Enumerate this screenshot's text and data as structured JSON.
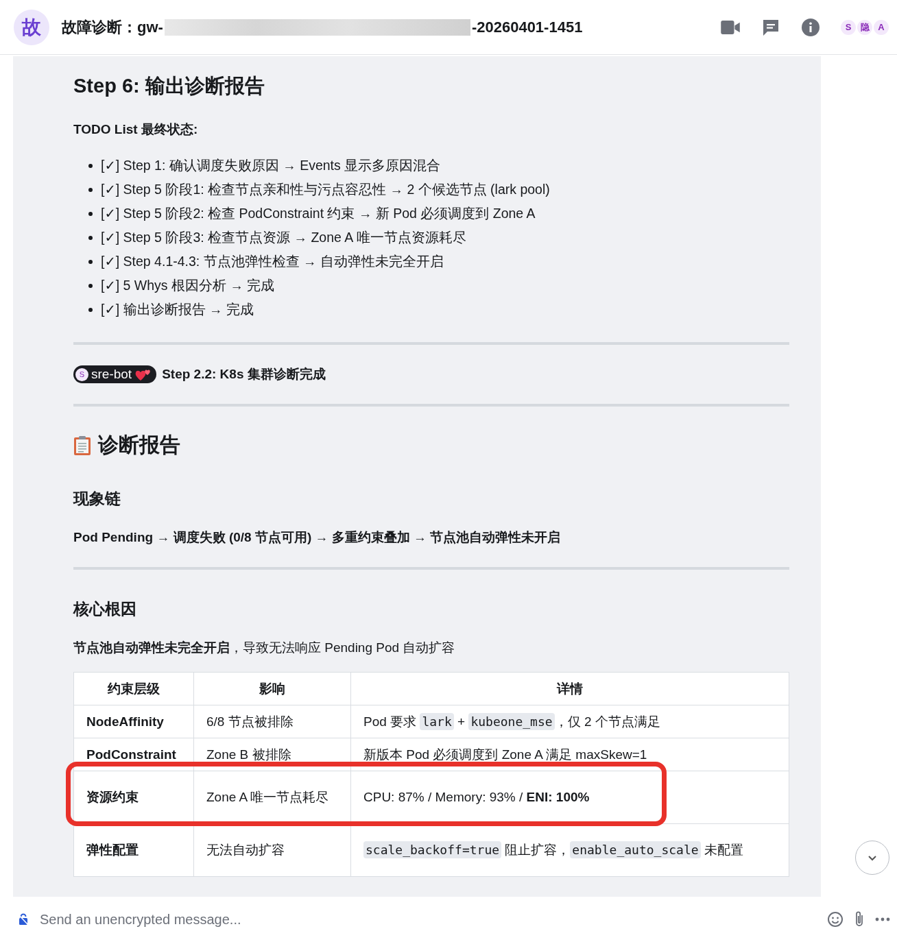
{
  "header": {
    "avatar": "故",
    "title_start": "故障诊断：gw-",
    "title_end": "-20260401-1451",
    "members": [
      "S",
      "隐",
      "A"
    ]
  },
  "step_heading": "Step 6: 输出诊断报告",
  "todo_title": "TODO List 最终状态:",
  "todo_items": [
    "[✓] Step 1: 确认调度失败原因 → Events 显示多原因混合",
    "[✓] Step 5 阶段1: 检查节点亲和性与污点容忍性 → 2 个候选节点 (lark pool)",
    "[✓] Step 5 阶段2: 检查 PodConstraint 约束 → 新 Pod 必须调度到 Zone A",
    "[✓] Step 5 阶段3: 检查节点资源 → Zone A 唯一节点资源耗尽",
    "[✓] Step 4.1-4.3: 节点池弹性检查 → 自动弹性未完全开启",
    "[✓] 5 Whys 根因分析 → 完成",
    "[✓] 输出诊断报告 → 完成"
  ],
  "bot_message": {
    "badge_avatar": "S",
    "badge": "sre-bot",
    "text": "Step 2.2: K8s 集群诊断完成"
  },
  "report_title": "诊断报告",
  "chain_heading": "现象链",
  "chain_text": "Pod Pending → 调度失败 (0/8 节点可用) → 多重约束叠加 → 节点池自动弹性未开启",
  "root_heading": "核心根因",
  "root_text": "**节点池自动弹性未完全开启**，导致无法响应 Pending Pod 自动扩容",
  "table": {
    "columns": [
      "约束层级",
      "影响",
      "详情"
    ],
    "rows": [
      {
        "highlighted": false,
        "level": "NodeAffinity",
        "impact": "6/8 节点被排除",
        "detail": [
          {
            "kind": "text",
            "text": "Pod 要求 "
          },
          {
            "kind": "code",
            "text": "lark"
          },
          {
            "kind": "text",
            "text": " + "
          },
          {
            "kind": "code",
            "text": "kubeone_mse"
          },
          {
            "kind": "text",
            "text": "，仅 2 个节点满足"
          }
        ]
      },
      {
        "highlighted": false,
        "level": "PodConstraint",
        "impact": "Zone B 被排除",
        "detail": [
          {
            "kind": "text",
            "text": "新版本 Pod 必须调度到 Zone A 满足 maxSkew=1"
          }
        ]
      },
      {
        "highlighted": true,
        "level": "资源约束",
        "impact": "Zone A 唯一节点耗尽",
        "detail": [
          {
            "kind": "text",
            "text": "CPU: 87% / Memory: 93% / "
          },
          {
            "kind": "bold",
            "text": "ENI: 100%"
          }
        ]
      },
      {
        "highlighted": false,
        "level": "弹性配置",
        "impact": "无法自动扩容",
        "detail": [
          {
            "kind": "code",
            "text": "scale_backoff=true"
          },
          {
            "kind": "text",
            "text": " 阻止扩容，"
          },
          {
            "kind": "code",
            "text": "enable_auto_scale"
          },
          {
            "kind": "text",
            "text": " 未配置"
          }
        ]
      }
    ]
  },
  "composer": {
    "placeholder": "Send an unencrypted message..."
  }
}
